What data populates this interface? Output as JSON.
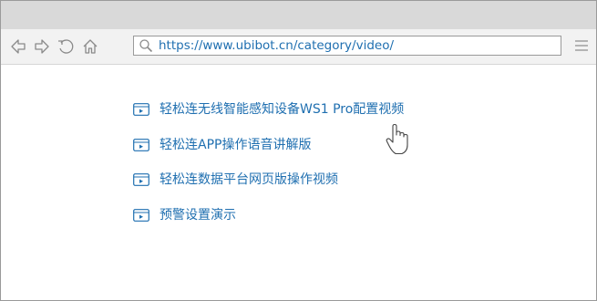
{
  "browser": {
    "address_bar": {
      "url": "https://www.ubibot.cn/category/video/"
    },
    "nav_icons": [
      "back-arrow-icon",
      "forward-arrow-icon",
      "refresh-icon",
      "home-icon"
    ],
    "menu_icon": "hamburger-menu-icon"
  },
  "content": {
    "links": [
      {
        "label": "轻松连无线智能感知设备WS1 Pro配置视频",
        "icon": "video-icon"
      },
      {
        "label": "轻松连APP操作语音讲解版",
        "icon": "video-icon"
      },
      {
        "label": "轻松连数据平台网页版操作视频",
        "icon": "video-icon"
      },
      {
        "label": "预警设置演示",
        "icon": "video-icon"
      }
    ]
  },
  "colors": {
    "link": "#1f6fb0",
    "titlebar": "#d9d9d9",
    "navbar": "#f2f2f2",
    "icon": "#8a8a8a"
  }
}
